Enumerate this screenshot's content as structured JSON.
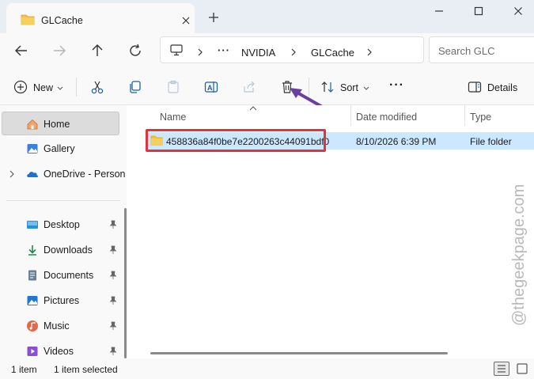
{
  "window": {
    "tab_title": "GLCache",
    "new_tab_symbol": "+"
  },
  "address": {
    "ellipsis": "···",
    "crumbs": [
      "NVIDIA",
      "GLCache"
    ],
    "search_placeholder": "Search GLC"
  },
  "toolbar": {
    "new_label": "New",
    "sort_label": "Sort",
    "more_label": "···",
    "details_label": "Details"
  },
  "sidebar": {
    "items": [
      {
        "label": "Home",
        "icon": "home-icon"
      },
      {
        "label": "Gallery",
        "icon": "gallery-icon"
      },
      {
        "label": "OneDrive - Person",
        "icon": "onedrive-icon"
      },
      {
        "label": "Desktop",
        "icon": "desktop-icon"
      },
      {
        "label": "Downloads",
        "icon": "downloads-icon"
      },
      {
        "label": "Documents",
        "icon": "documents-icon"
      },
      {
        "label": "Pictures",
        "icon": "pictures-icon"
      },
      {
        "label": "Music",
        "icon": "music-icon"
      },
      {
        "label": "Videos",
        "icon": "videos-icon"
      }
    ]
  },
  "table": {
    "columns": [
      "Name",
      "Date modified",
      "Type"
    ],
    "rows": [
      {
        "name": "458836a84f0be7e2200263c44091bdf0",
        "date": "8/10/2026 6:39 PM",
        "type": "File folder"
      }
    ]
  },
  "status": {
    "count": "1 item",
    "selection": "1 item selected"
  },
  "watermark": "@thegeekpage.com",
  "colors": {
    "highlight": "#e0343a",
    "arrow": "#6a3fa0",
    "selection": "#cce8ff",
    "folder": "#f4c144"
  }
}
